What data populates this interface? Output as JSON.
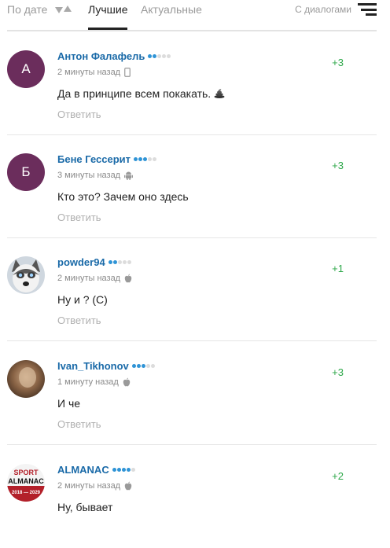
{
  "tabs": {
    "by_date": "По дате",
    "best": "Лучшие",
    "actual": "Актуальные",
    "with_dialogs": "С диалогами"
  },
  "comments": [
    {
      "author": "Антон Фалафель",
      "rating_dots": 2,
      "time": "2 минуты назад",
      "device": "mobile-phone-icon",
      "text": "Да в принципе всем покакать.",
      "emoji": "💩",
      "reply": "Ответить",
      "score": "+3",
      "avatar_letter": "А"
    },
    {
      "author": "Бене Гессерит",
      "rating_dots": 3,
      "time": "3 минуты назад",
      "device": "android-icon",
      "text": "Кто это? Зачем оно здесь",
      "reply": "Ответить",
      "score": "+3",
      "avatar_letter": "Б"
    },
    {
      "author": "powder94",
      "rating_dots": 2,
      "time": "2 минуты назад",
      "device": "apple-icon",
      "text": "Ну и ? (С)",
      "reply": "Ответить",
      "score": "+1"
    },
    {
      "author": "Ivan_Tikhonov",
      "rating_dots": 3,
      "time": "1 минуту назад",
      "device": "apple-icon",
      "text": "И че",
      "reply": "Ответить",
      "score": "+3"
    },
    {
      "author": "ALMANAC",
      "rating_dots": 4,
      "time": "2 минуты назад",
      "device": "apple-icon",
      "text": "Ну, бывает",
      "reply": "Ответить",
      "score": "+2",
      "avatar_text_top": "SPORT",
      "avatar_text_mid": "ALMANAC",
      "avatar_text_bottom": "2018 — 2029"
    }
  ],
  "colors": {
    "author": "#1a6aa8",
    "score": "#2ea84a",
    "avatar_letter_bg": "#6b2d5c",
    "rating_on": "#2f94d6"
  }
}
